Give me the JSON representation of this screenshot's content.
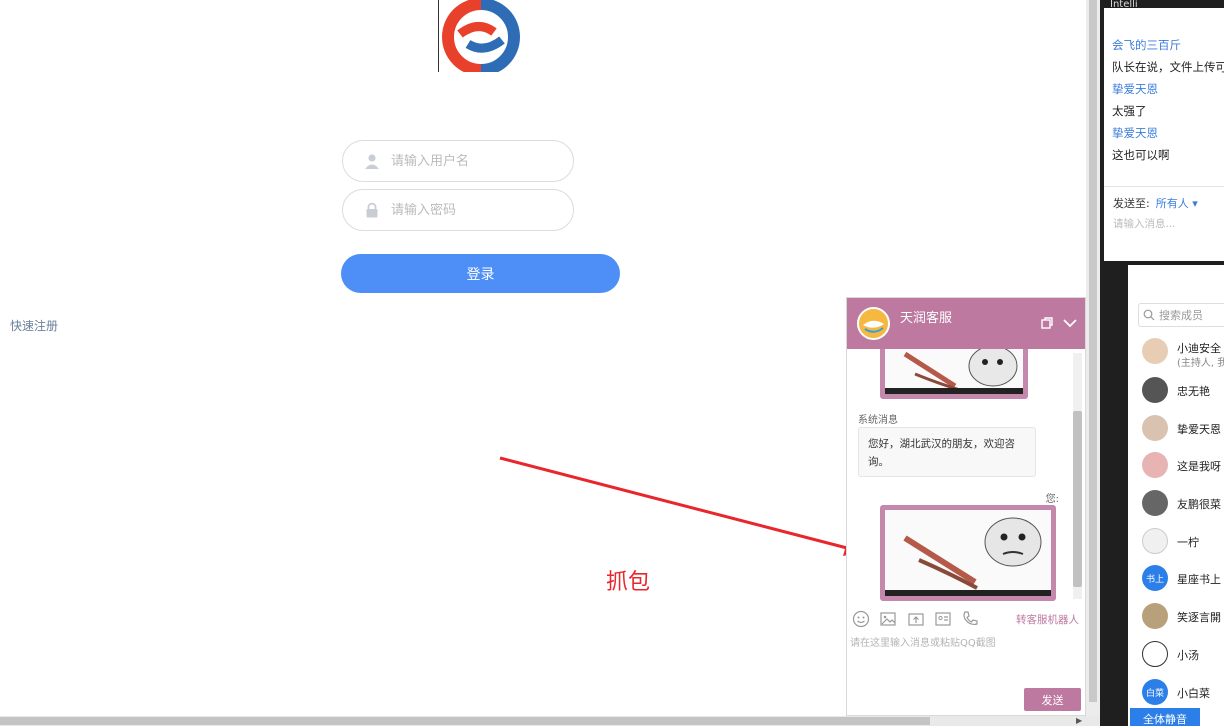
{
  "login": {
    "username_placeholder": "请输入用户名",
    "password_placeholder": "请输入密码",
    "login_label": "登录",
    "register_label": "快速注册"
  },
  "annotation": {
    "label": "抓包",
    "arrow_color": "#e8262c"
  },
  "chat_widget": {
    "title": "天润客服",
    "system_label": "系统消息",
    "system_message": "您好，湖北武汉的朋友，欢迎咨询。",
    "you_label": "您:",
    "transfer_label": "转客服机器人",
    "input_placeholder": "请在这里输入消息或粘贴QQ截图",
    "send_label": "发送",
    "accent_color": "#bd79a0",
    "toolbar_icons": [
      "smile-icon",
      "image-icon",
      "upload-icon",
      "card-icon",
      "phone-icon"
    ]
  },
  "meeting": {
    "window_title": "Intelli",
    "messages": [
      {
        "name": "会飞的三百斤",
        "text": "队长在说，文件上传可"
      },
      {
        "name": "挚爱天恩",
        "text": "太强了"
      },
      {
        "name": "挚爱天恩",
        "text": "这也可以啊"
      }
    ],
    "send_to_label": "发送至:",
    "send_to_target": "所有人",
    "input_placeholder": "请输入消息...",
    "search_placeholder": "搜索成员",
    "members": [
      {
        "name": "小迪安全",
        "sub": "(主持人, 我"
      },
      {
        "name": "忠无艳"
      },
      {
        "name": "挚爱天恩"
      },
      {
        "name": "这是我呀"
      },
      {
        "name": "友鹏很菜"
      },
      {
        "name": "一柠"
      },
      {
        "name": "星座书上",
        "avatar_text": "书上"
      },
      {
        "name": "笑逐言開"
      },
      {
        "name": "小汤"
      },
      {
        "name": "小白菜",
        "avatar_text": "白菜"
      }
    ],
    "mute_all_label": "全体静音"
  }
}
